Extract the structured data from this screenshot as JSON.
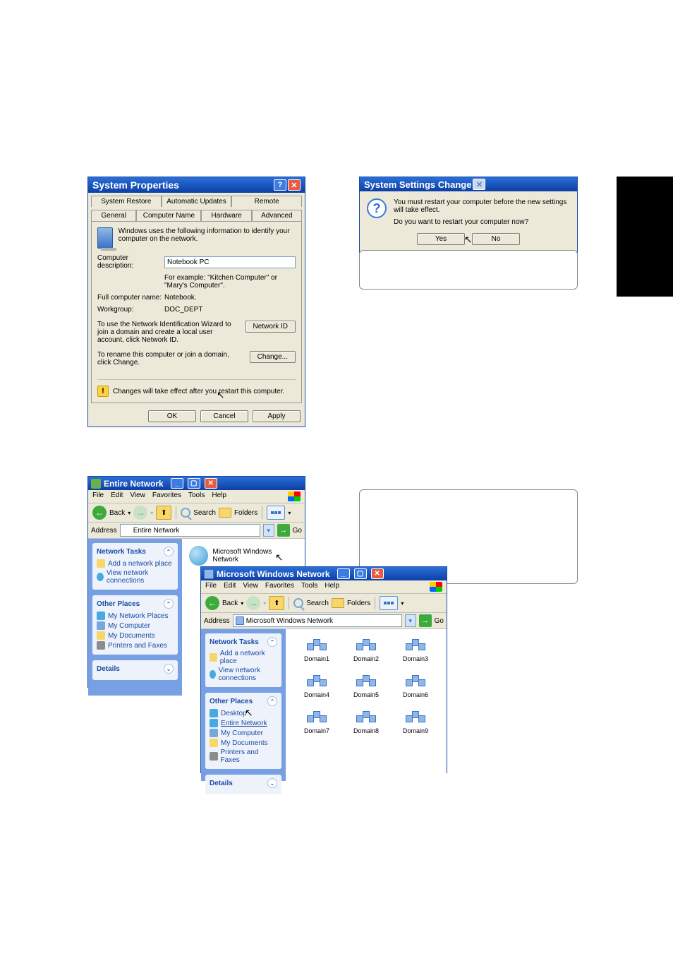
{
  "sysprop": {
    "title": "System Properties",
    "tabs_row1": [
      "System Restore",
      "Automatic Updates",
      "Remote"
    ],
    "tabs_row2": [
      "General",
      "Computer Name",
      "Hardware",
      "Advanced"
    ],
    "intro": "Windows uses the following information to identify your computer on the network.",
    "desc_label": "Computer description:",
    "desc_value": "Notebook PC",
    "desc_hint": "For example: \"Kitchen Computer\" or \"Mary's Computer\".",
    "fullname_label": "Full computer name:",
    "fullname_value": "Notebook.",
    "workgroup_label": "Workgroup:",
    "workgroup_value": "DOC_DEPT",
    "wizard_text": "To use the Network Identification Wizard to join a domain and create a local user account, click Network ID.",
    "network_id_btn": "Network ID",
    "change_text": "To rename this computer or join a domain, click Change.",
    "change_btn": "Change...",
    "warn_text": "Changes will take effect after you restart this computer.",
    "ok": "OK",
    "cancel": "Cancel",
    "apply": "Apply"
  },
  "syschange": {
    "title": "System Settings Change",
    "line1": "You must restart your computer before the new settings will take effect.",
    "line2": "Do you want to restart your computer now?",
    "yes": "Yes",
    "no": "No"
  },
  "explorer1": {
    "title": "Entire Network",
    "menus": [
      "File",
      "Edit",
      "View",
      "Favorites",
      "Tools",
      "Help"
    ],
    "back": "Back",
    "search": "Search",
    "folders": "Folders",
    "addr_label": "Address",
    "addr_value": "Entire Network",
    "go": "Go",
    "task_hd": "Network Tasks",
    "task1": "Add a network place",
    "task2": "View network connections",
    "other_hd": "Other Places",
    "op1": "My Network Places",
    "op2": "My Computer",
    "op3": "My Documents",
    "op4": "Printers and Faxes",
    "details_hd": "Details",
    "content_label": "Microsoft Windows Network"
  },
  "explorer2": {
    "title": "Microsoft Windows Network",
    "menus": [
      "File",
      "Edit",
      "View",
      "Favorites",
      "Tools",
      "Help"
    ],
    "back": "Back",
    "search": "Search",
    "folders": "Folders",
    "addr_label": "Address",
    "addr_value": "Microsoft Windows Network",
    "go": "Go",
    "task_hd": "Network Tasks",
    "task1": "Add a network place",
    "task2": "View network connections",
    "other_hd": "Other Places",
    "op0": "Desktop",
    "op1": "Entire Network",
    "op2": "My Computer",
    "op3": "My Documents",
    "op4": "Printers and Faxes",
    "details_hd": "Details",
    "domains": [
      "Domain1",
      "Domain2",
      "Domain3",
      "Domain4",
      "Domain5",
      "Domain6",
      "Domain7",
      "Domain8",
      "Domain9"
    ]
  }
}
